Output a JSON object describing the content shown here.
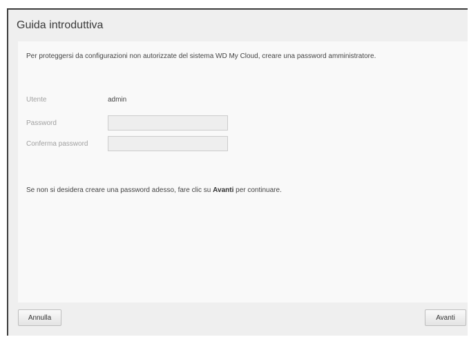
{
  "dialog": {
    "title": "Guida introduttiva",
    "intro": "Per proteggersi da configurazioni non autorizzate del sistema WD My Cloud, creare una password amministratore.",
    "form": {
      "user_label": "Utente",
      "user_value": "admin",
      "password_label": "Password",
      "password_value": "",
      "confirm_label": "Conferma password",
      "confirm_value": ""
    },
    "hint": {
      "before": "Se non si desidera creare una password adesso, fare clic su ",
      "bold": "Avanti",
      "after": " per continuare."
    },
    "buttons": {
      "cancel_label": "Annulla",
      "next_label": "Avanti"
    }
  }
}
